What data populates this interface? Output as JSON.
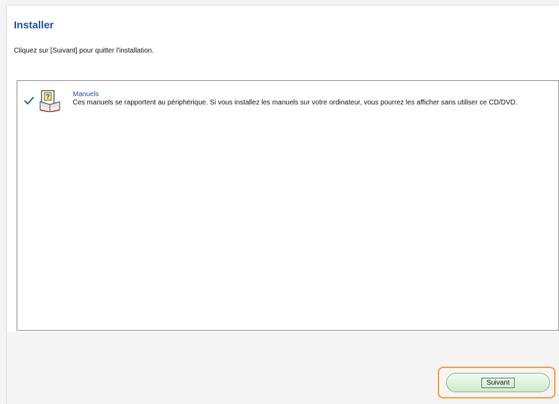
{
  "page": {
    "title": "Installer",
    "instruction": "Cliquez sur [Suivant] pour quitter l'installation."
  },
  "list": {
    "items": [
      {
        "title": "Manuels",
        "description": "Ces manuels se rapportent au périphérique. Si vous installez les manuels sur votre ordinateur, vous pourrez les afficher sans utiliser ce CD/DVD.",
        "checked": true,
        "icon": "manual-book-icon"
      }
    ]
  },
  "footer": {
    "next_label": "Suivant"
  },
  "colors": {
    "title": "#1f4e9c",
    "highlight": "#f1a034",
    "button_fill": "#cfeacd"
  }
}
